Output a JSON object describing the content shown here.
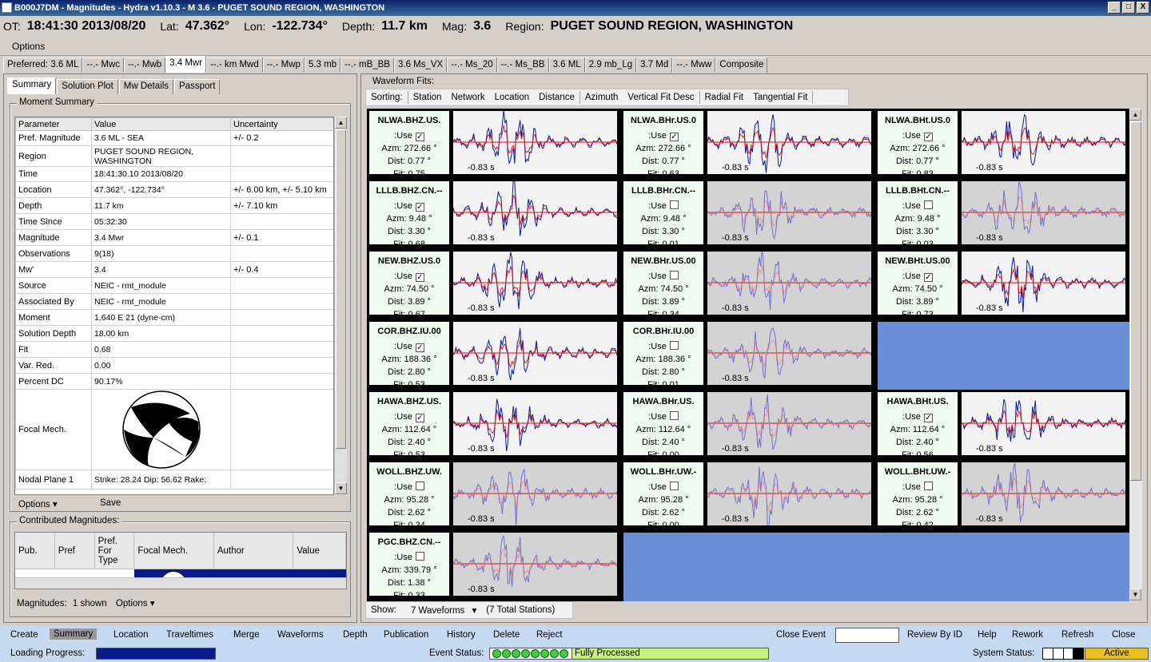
{
  "window": {
    "title": "B000J7DM - Magnitudes - Hydra v1.10.3 -  M 3.6  -  PUGET SOUND REGION, WASHINGTON",
    "minimize": "_",
    "maximize": "□",
    "close": "X"
  },
  "event": {
    "ot_label": "OT:",
    "ot": "18:41:30 2013/08/20",
    "lat_label": "Lat:",
    "lat": "47.362°",
    "lon_label": "Lon:",
    "lon": "-122.734°",
    "depth_label": "Depth:",
    "depth": "11.7 km",
    "mag_label": "Mag:",
    "mag": "3.6",
    "region_label": "Region:",
    "region": "PUGET SOUND REGION, WASHINGTON"
  },
  "menu": {
    "options": "Options"
  },
  "mag_tabs": [
    "Preferred: 3.6 ML",
    "--.- Mwc",
    "--.- Mwb",
    "3.4 Mwr",
    "--.- km Mwd",
    "--.- Mwp",
    "5.3 mb",
    "--.- mB_BB",
    "3.6 Ms_VX",
    "--.- Ms_20",
    "--.- Ms_BB",
    "3.6 ML",
    "2.9 mb_Lg",
    "3.7 Md",
    "--.- Mww",
    "Composite"
  ],
  "sub_tabs": [
    "Summary",
    "Solution Plot",
    "Mw Details",
    "Passport"
  ],
  "moment_summary": {
    "title": "Moment Summary",
    "headers": [
      "Parameter",
      "Value",
      "Uncertainty"
    ],
    "rows": [
      [
        "Pref. Magnitude",
        "3.6 ML - SEA",
        "+/- 0.2"
      ],
      [
        "Region",
        "PUGET SOUND REGION, WASHINGTON",
        ""
      ],
      [
        "Time",
        "18:41:30.10 2013/08/20",
        ""
      ],
      [
        "Location",
        "47.362°, -122.734°",
        "+/- 6.00 km, +/- 5.10 km"
      ],
      [
        "Depth",
        "11.7 km",
        "+/- 7.10 km"
      ],
      [
        "Time Since",
        "05:32:30",
        ""
      ],
      [
        "Magnitude",
        "3.4 Mwr",
        "+/- 0.1"
      ],
      [
        "Observations",
        "9(18)",
        ""
      ],
      [
        "Mw'",
        "3.4",
        "+/- 0.4"
      ],
      [
        "Source",
        "NEIC - rmt_module",
        ""
      ],
      [
        "Associated By",
        "NEIC - rmt_module",
        ""
      ],
      [
        "Moment",
        "1.640 E 21 (dyne-cm)",
        ""
      ],
      [
        "Solution Depth",
        "18.00 km",
        ""
      ],
      [
        "Fit",
        "0.68",
        ""
      ],
      [
        "Var. Red.",
        "0.00",
        ""
      ],
      [
        "Percent DC",
        "90.17%",
        ""
      ],
      [
        "Focal Mech.",
        "",
        ""
      ],
      [
        "Nodal Plane 1",
        "Strike: 28.24  Dip: 56.62  Rake:",
        ""
      ]
    ],
    "options_btn": "Options",
    "save_btn": "Save"
  },
  "contributed": {
    "title": "Contributed Magnitudes:",
    "headers": [
      "Pub.",
      "Pref",
      "Pref. For Type",
      "Focal Mech.",
      "Author",
      "Value"
    ],
    "footer_label": "Magnitudes:",
    "footer_count": "1 shown",
    "footer_options": "Options"
  },
  "waveforms": {
    "title": "Waveform Fits:",
    "sorting_label": "Sorting:",
    "sort_options": [
      "Station",
      "Network",
      "Location",
      "Distance",
      "Azimuth",
      "Vertical Fit Desc",
      "Radial Fit",
      "Tangential Fit"
    ],
    "cells": [
      {
        "sta": "NLWA.BHZ.US.",
        "use_label": ":Use",
        "use": true,
        "azm": "Azm: 272.66 °",
        "dist": "Dist: 0.77 °",
        "fit": "Fit: 0.75",
        "shift": "-0.83 s",
        "dim": false
      },
      {
        "sta": "NLWA.BHr.US.0",
        "use_label": ":Use",
        "use": true,
        "azm": "Azm: 272.66 °",
        "dist": "Dist: 0.77 °",
        "fit": "Fit: 0.63",
        "shift": "-0.83 s",
        "dim": false
      },
      {
        "sta": "NLWA.BHt.US.0",
        "use_label": ":Use",
        "use": true,
        "azm": "Azm: 272.66 °",
        "dist": "Dist: 0.77 °",
        "fit": "Fit: 0.83",
        "shift": "-0.83 s",
        "dim": false
      },
      {
        "sta": "LLLB.BHZ.CN.--",
        "use_label": ":Use",
        "use": true,
        "azm": "Azm: 9.48 °",
        "dist": "Dist: 3.30 °",
        "fit": "Fit: 0.68",
        "shift": "-0.83 s",
        "dim": false
      },
      {
        "sta": "LLLB.BHr.CN.--",
        "use_label": ":Use",
        "use": false,
        "azm": "Azm: 9.48 °",
        "dist": "Dist: 3.30 °",
        "fit": "Fit: 0.01",
        "shift": "-0.83 s",
        "dim": true
      },
      {
        "sta": "LLLB.BHt.CN.--",
        "use_label": ":Use",
        "use": false,
        "azm": "Azm: 9.48 °",
        "dist": "Dist: 3.30 °",
        "fit": "Fit: 0.03",
        "shift": "-0.83 s",
        "dim": true
      },
      {
        "sta": "NEW.BHZ.US.0",
        "use_label": ":Use",
        "use": true,
        "azm": "Azm: 74.50 °",
        "dist": "Dist: 3.89 °",
        "fit": "Fit: 0.67",
        "shift": "-0.83 s",
        "dim": false
      },
      {
        "sta": "NEW.BHr.US.00",
        "use_label": ":Use",
        "use": false,
        "azm": "Azm: 74.50 °",
        "dist": "Dist: 3.89 °",
        "fit": "Fit: 0.34",
        "shift": "-0.83 s",
        "dim": true
      },
      {
        "sta": "NEW.BHt.US.00",
        "use_label": ":Use",
        "use": true,
        "azm": "Azm: 74.50 °",
        "dist": "Dist: 3.89 °",
        "fit": "Fit: 0.73",
        "shift": "-0.83 s",
        "dim": false
      },
      {
        "sta": "COR.BHZ.IU.00",
        "use_label": ":Use",
        "use": true,
        "azm": "Azm: 188.36 °",
        "dist": "Dist: 2.80 °",
        "fit": "Fit: 0.53",
        "shift": "-0.83 s",
        "dim": false
      },
      {
        "sta": "COR.BHr.IU.00",
        "use_label": ":Use",
        "use": false,
        "azm": "Azm: 188.36 °",
        "dist": "Dist: 2.80 °",
        "fit": "Fit: 0.01",
        "shift": "-0.83 s",
        "dim": true
      },
      null,
      {
        "sta": "HAWA.BHZ.US.",
        "use_label": ":Use",
        "use": true,
        "azm": "Azm: 112.64 °",
        "dist": "Dist: 2.40 °",
        "fit": "Fit: 0.53",
        "shift": "-0.83 s",
        "dim": false
      },
      {
        "sta": "HAWA.BHr.US.",
        "use_label": ":Use",
        "use": false,
        "azm": "Azm: 112.64 °",
        "dist": "Dist: 2.40 °",
        "fit": "Fit: 0.00",
        "shift": "-0.83 s",
        "dim": true
      },
      {
        "sta": "HAWA.BHt.US.",
        "use_label": ":Use",
        "use": true,
        "azm": "Azm: 112.64 °",
        "dist": "Dist: 2.40 °",
        "fit": "Fit: 0.56",
        "shift": "-0.83 s",
        "dim": false
      },
      {
        "sta": "WOLL.BHZ.UW.",
        "use_label": ":Use",
        "use": false,
        "azm": "Azm: 95.28 °",
        "dist": "Dist: 2.62 °",
        "fit": "Fit: 0.34",
        "shift": "-0.83 s",
        "dim": true
      },
      {
        "sta": "WOLL.BHr.UW.-",
        "use_label": ":Use",
        "use": false,
        "azm": "Azm: 95.28 °",
        "dist": "Dist: 2.62 °",
        "fit": "Fit: 0.00",
        "shift": "-0.83 s",
        "dim": true
      },
      {
        "sta": "WOLL.BHt.UW.-",
        "use_label": ":Use",
        "use": false,
        "azm": "Azm: 95.28 °",
        "dist": "Dist: 2.62 °",
        "fit": "Fit: 0.42",
        "shift": "-0.83 s",
        "dim": true
      },
      {
        "sta": "PGC.BHZ.CN.--",
        "use_label": ":Use",
        "use": false,
        "azm": "Azm: 339.79 °",
        "dist": "Dist: 1.38 °",
        "fit": "Fit: 0.33",
        "shift": "-0.83 s",
        "dim": true
      }
    ],
    "show_label": "Show:",
    "show_value": "7 Waveforms",
    "total": "(7 Total Stations)"
  },
  "actions_left": [
    "Create",
    "Summary",
    "Location",
    "Traveltimes",
    "Merge",
    "Waveforms",
    "Depth",
    "Publication",
    "History",
    "Delete",
    "Reject"
  ],
  "actions_right": [
    "Close Event",
    "Review By ID",
    "Help",
    "Rework",
    "Refresh",
    "Close"
  ],
  "status": {
    "loading_label": "Loading Progress:",
    "event_status_label": "Event Status:",
    "event_status": "Fully Processed",
    "system_status_label": "System Status:",
    "system_status": "Active"
  },
  "colors": {
    "grid_bg": "#6b8fd6",
    "synthetic": "#d01010",
    "observed": "#0a1aa0",
    "active_tab": "#ffffff",
    "status_green": "#c8f080"
  }
}
